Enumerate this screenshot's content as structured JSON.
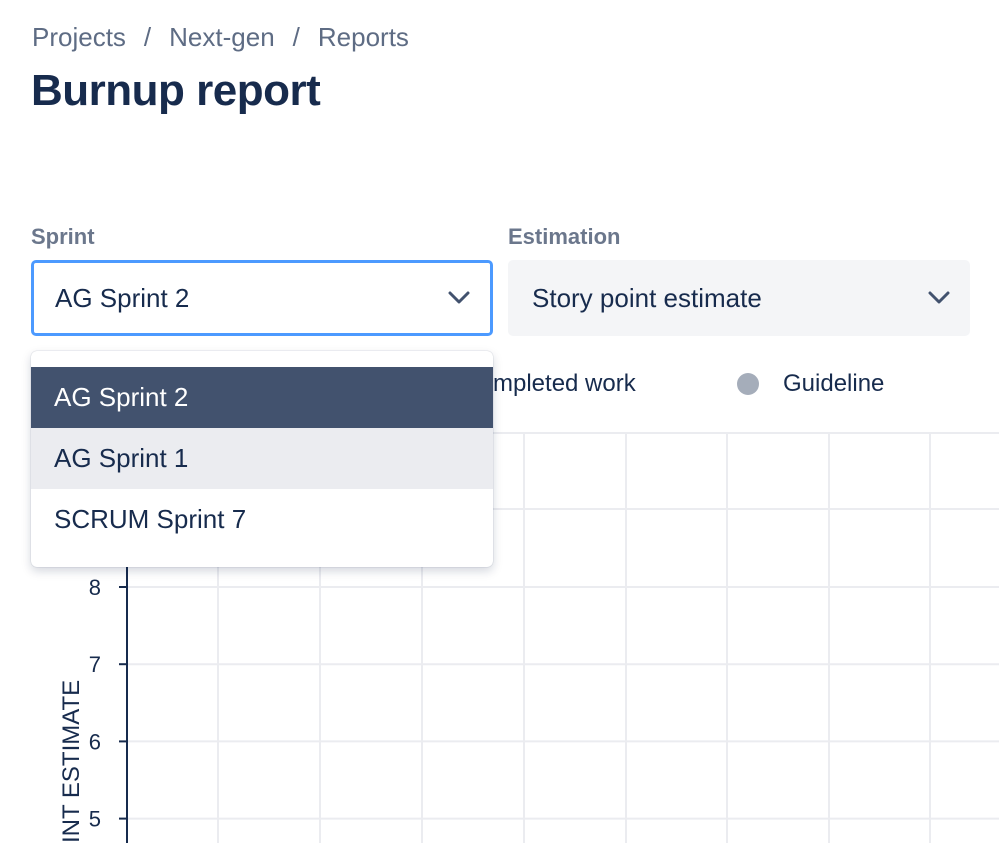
{
  "breadcrumb": {
    "items": [
      "Projects",
      "Next-gen",
      "Reports"
    ],
    "separator": "/"
  },
  "page": {
    "title": "Burnup report"
  },
  "filters": {
    "sprint": {
      "label": "Sprint",
      "value": "AG Sprint 2",
      "focused": true,
      "icon": "chevron-down-icon"
    },
    "estimation": {
      "label": "Estimation",
      "value": "Story point estimate",
      "icon": "chevron-down-icon"
    }
  },
  "dropdown": {
    "open": true,
    "options": [
      {
        "label": "AG Sprint 2",
        "state": "selected"
      },
      {
        "label": "AG Sprint 1",
        "state": "hovered"
      },
      {
        "label": "SCRUM Sprint 7",
        "state": "normal"
      }
    ]
  },
  "legend": {
    "items": [
      {
        "label": "mpleted work",
        "note": "partially hidden behind dropdown"
      },
      {
        "label": "Guideline",
        "color": "#a5adba"
      }
    ]
  },
  "chart_data": {
    "type": "line",
    "ylabel": "INT ESTIMATE",
    "visible_yticks": [
      8,
      7,
      6,
      5
    ],
    "grid": true,
    "series": []
  },
  "colors": {
    "focus_border": "#4c9aff",
    "selected_option_bg": "#42526e",
    "hovered_option_bg": "#ebecf0",
    "text_primary": "#172b4d",
    "text_secondary": "#6b778c",
    "grid": "#ebecf0",
    "axis": "#172b4d"
  }
}
